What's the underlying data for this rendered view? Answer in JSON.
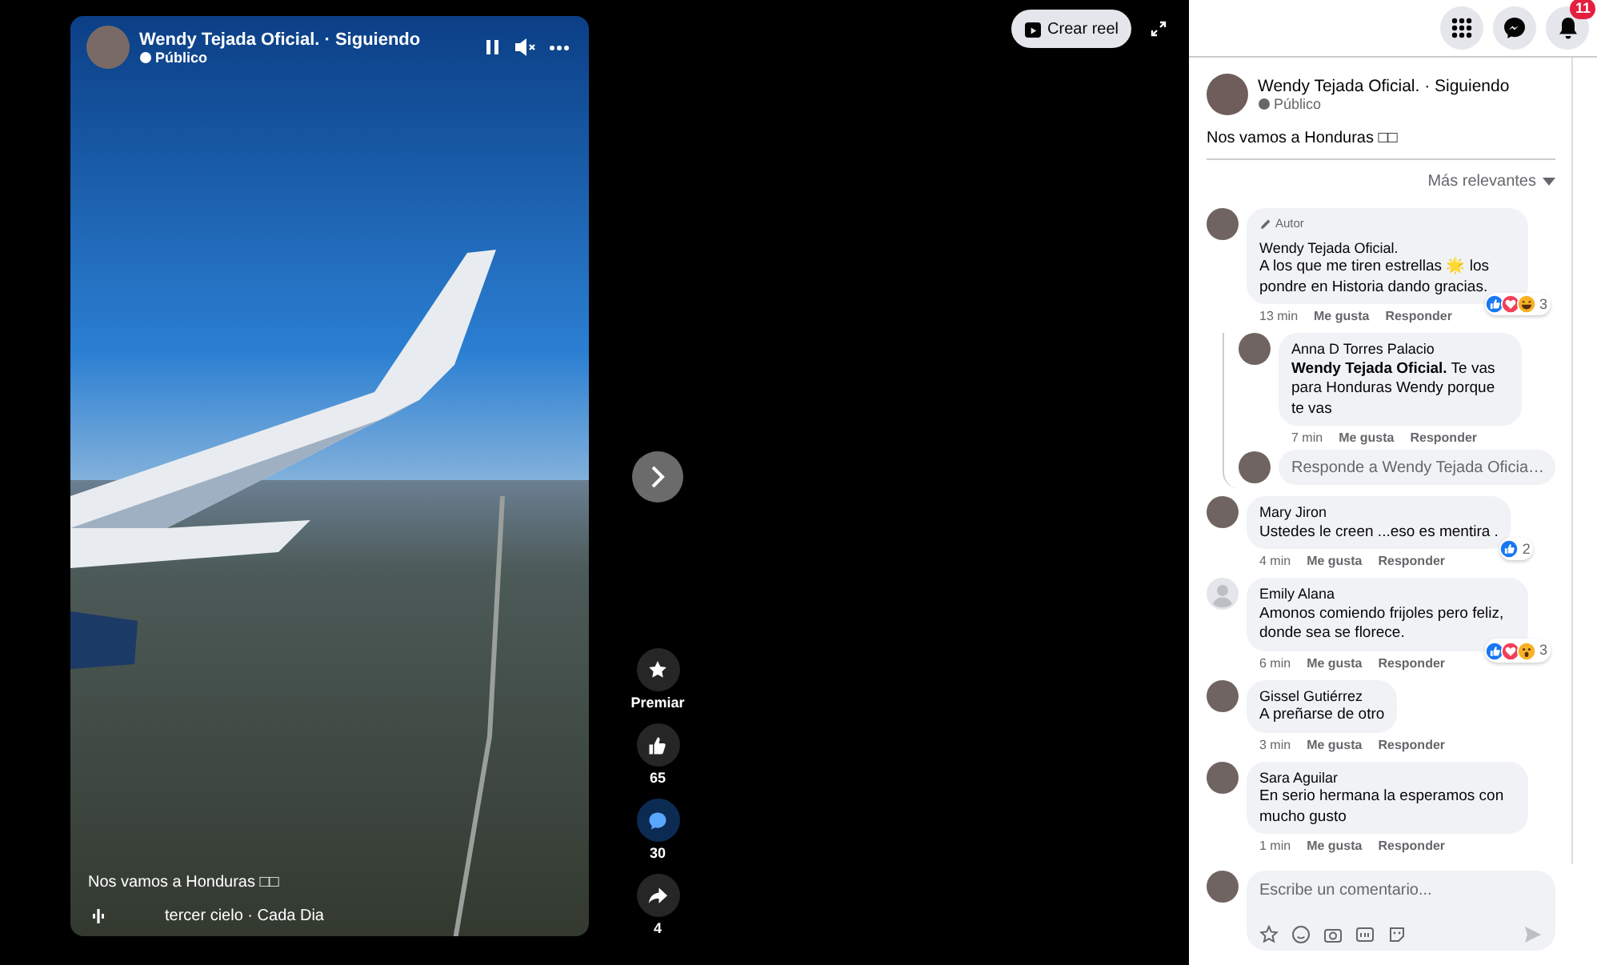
{
  "video": {
    "title": "Wendy Tejada Oficial. · Siguiendo",
    "audience": "Público",
    "caption": "Nos vamos a Honduras □□",
    "music": "tercer cielo · Cada Dia"
  },
  "side_actions": [
    {
      "kind": "star",
      "label": "Premiar",
      "selected": false
    },
    {
      "kind": "like",
      "label": "65",
      "selected": false
    },
    {
      "kind": "comment",
      "label": "30",
      "selected": true
    },
    {
      "kind": "share",
      "label": "4",
      "selected": false
    }
  ],
  "toolbar": {
    "create_reel": "Crear reel"
  },
  "top_bar": {
    "notification_count": "11"
  },
  "post": {
    "title": "Wendy Tejada Oficial. · Siguiendo",
    "audience": "Público",
    "text": "Nos vamos a Honduras □□"
  },
  "sort": {
    "label": "Más relevantes"
  },
  "comments": [
    {
      "avatar": {
        "kind": "photo"
      },
      "badge": "Autor",
      "author": "Wendy Tejada Oficial.",
      "text": "A los que me tiren estrellas 🌟 los pondre en Historia dando gracias.",
      "time": "13 min",
      "like": "Me gusta",
      "reply": "Responder",
      "reactions": [
        {
          "kind": "like"
        },
        {
          "kind": "love"
        },
        {
          "kind": "haha"
        }
      ],
      "reaction_count": "3",
      "replies": [
        {
          "avatar": {
            "kind": "photo"
          },
          "author": "Anna D Torres Palacio",
          "text": "**Wendy Tejada Oficial.** Te vas para Honduras Wendy porque te vas",
          "time": "7 min",
          "like": "Me gusta",
          "reply": "Responder"
        }
      ],
      "reply_composer": {
        "placeholder": "Responde a Wendy Tejada Oficia…"
      }
    },
    {
      "avatar": {
        "kind": "photo"
      },
      "author": "Mary Jiron",
      "text": "Ustedes le creen ...eso es mentira .",
      "time": "4 min",
      "like": "Me gusta",
      "reply": "Responder",
      "reactions": [
        {
          "kind": "like"
        }
      ],
      "reaction_count": "2"
    },
    {
      "avatar": {
        "kind": "default"
      },
      "author": "Emily Alana",
      "text": "Amonos comiendo frijoles pero feliz, donde sea se florece.",
      "time": "6 min",
      "like": "Me gusta",
      "reply": "Responder",
      "reactions": [
        {
          "kind": "like"
        },
        {
          "kind": "love"
        },
        {
          "kind": "wow"
        }
      ],
      "reaction_count": "3"
    },
    {
      "avatar": {
        "kind": "photo"
      },
      "author": "Gissel Gutiérrez",
      "text": "A preñarse de otro",
      "time": "3 min",
      "like": "Me gusta",
      "reply": "Responder"
    },
    {
      "avatar": {
        "kind": "photo"
      },
      "author": "Sara Aguilar",
      "text": "En serio hermana la esperamos con mucho gusto",
      "time": "1 min",
      "like": "Me gusta",
      "reply": "Responder"
    }
  ],
  "composer": {
    "placeholder": "Escribe un comentario..."
  }
}
